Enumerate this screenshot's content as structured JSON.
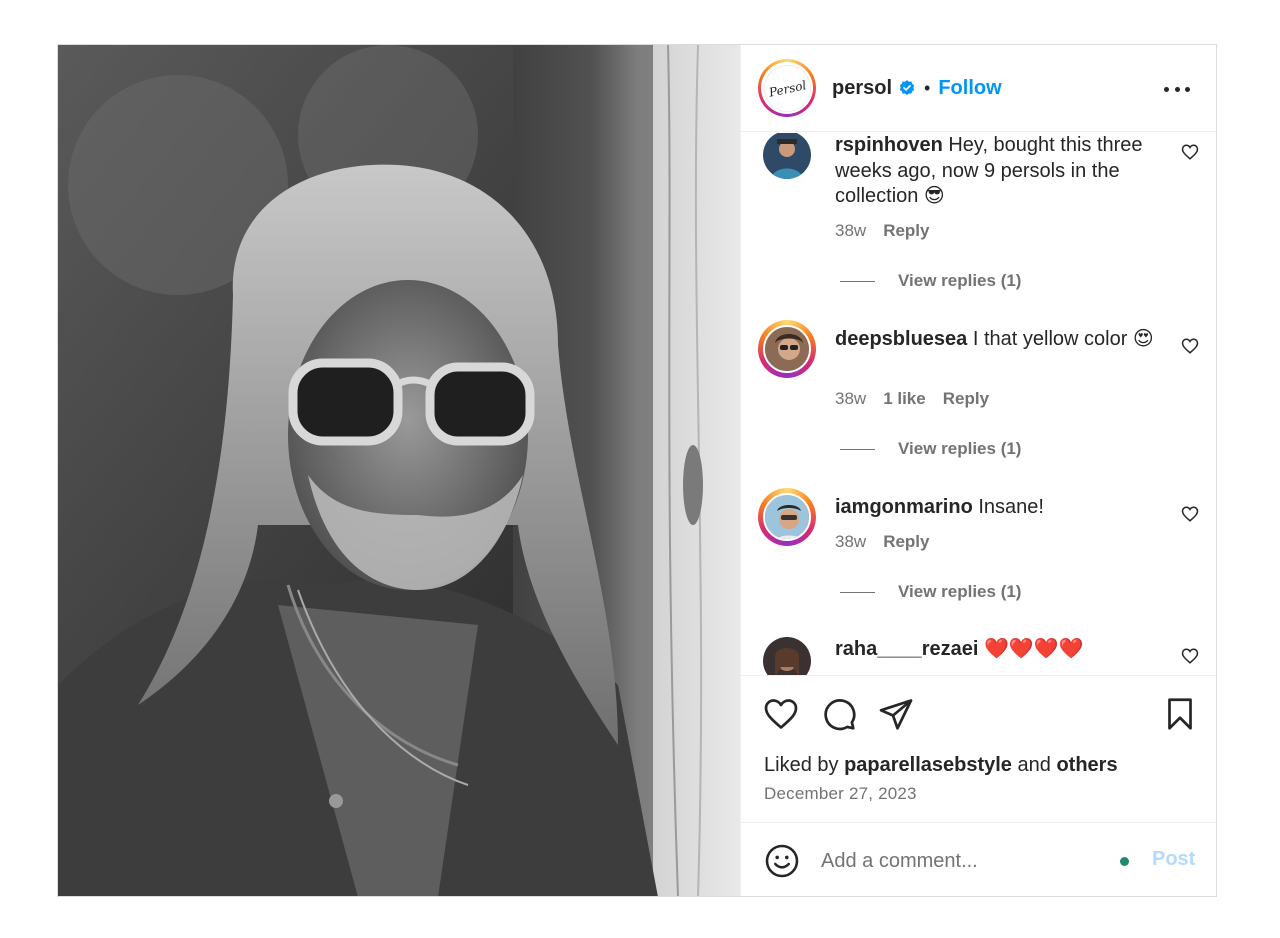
{
  "header": {
    "username": "persol",
    "avatar_logo_text": "Persol",
    "separator": "•",
    "follow_label": "Follow",
    "icons": {
      "verified": "verified-badge-icon",
      "more": "more-options-icon"
    },
    "accent_color": "#0095f6"
  },
  "comments": [
    {
      "username": "rspinhoven",
      "text": "Hey, bought this three weeks ago, now 9 persols in the collection 😎",
      "age": "38w",
      "likes": "",
      "reply_label": "Reply",
      "view_replies": "View replies (1)"
    },
    {
      "username": "deepsbluesea",
      "text": "I that yellow color 😍",
      "age": "38w",
      "likes": "1 like",
      "reply_label": "Reply",
      "view_replies": "View replies (1)"
    },
    {
      "username": "iamgonmarino",
      "text": "Insane!",
      "age": "38w",
      "likes": "",
      "reply_label": "Reply",
      "view_replies": "View replies (1)"
    },
    {
      "username": "raha____rezaei",
      "text": "❤️❤️❤️❤️",
      "age": "",
      "likes": "",
      "reply_label": "",
      "view_replies": ""
    }
  ],
  "actions": {
    "icons": [
      "heart-icon",
      "comment-icon",
      "share-icon",
      "bookmark-icon"
    ],
    "liked_prefix": "Liked by",
    "liked_user": "paparellasebstyle",
    "liked_and": "and",
    "liked_others": "others",
    "date": "December 27, 2023"
  },
  "add_comment": {
    "placeholder": "Add a comment...",
    "post_label": "Post",
    "emoji_icon": "emoji-icon"
  }
}
